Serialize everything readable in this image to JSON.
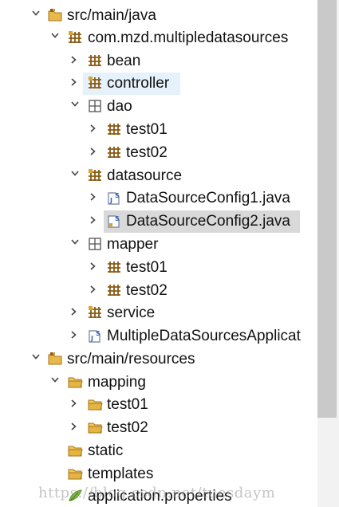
{
  "tree": {
    "items": [
      {
        "label": "src/main/java",
        "icon": "source-folder-icon",
        "expanded": true
      },
      {
        "label": "com.mzd.multipledatasources",
        "icon": "package-icon",
        "expanded": true
      },
      {
        "label": "bean",
        "icon": "package-icon",
        "expanded": false
      },
      {
        "label": "controller",
        "icon": "package-icon",
        "expanded": false,
        "highlighted": true
      },
      {
        "label": "dao",
        "icon": "empty-package-icon",
        "expanded": true
      },
      {
        "label": "test01",
        "icon": "package-icon",
        "expanded": false
      },
      {
        "label": "test02",
        "icon": "package-icon",
        "expanded": false
      },
      {
        "label": "datasource",
        "icon": "package-icon",
        "expanded": true
      },
      {
        "label": "DataSourceConfig1.java",
        "icon": "java-file-icon",
        "expanded": false
      },
      {
        "label": "DataSourceConfig2.java",
        "icon": "java-file-icon",
        "expanded": false,
        "selected": true
      },
      {
        "label": "mapper",
        "icon": "empty-package-icon",
        "expanded": true
      },
      {
        "label": "test01",
        "icon": "package-icon",
        "expanded": false
      },
      {
        "label": "test02",
        "icon": "package-icon",
        "expanded": false
      },
      {
        "label": "service",
        "icon": "package-icon",
        "expanded": false
      },
      {
        "label": "MultipleDataSourcesApplicat",
        "icon": "java-file-icon",
        "expanded": false
      },
      {
        "label": "src/main/resources",
        "icon": "source-folder-icon",
        "expanded": true
      },
      {
        "label": "mapping",
        "icon": "folder-icon",
        "expanded": true
      },
      {
        "label": "test01",
        "icon": "folder-icon",
        "expanded": false
      },
      {
        "label": "test02",
        "icon": "folder-icon",
        "expanded": false
      },
      {
        "label": "static",
        "icon": "folder-icon"
      },
      {
        "label": "templates",
        "icon": "folder-icon"
      },
      {
        "label": "application.properties",
        "icon": "properties-file-icon"
      }
    ]
  },
  "watermark": "https://blog.csdn.net/tuesdaym",
  "colors": {
    "highlight": "#e5f1fb",
    "selected": "#d9d9d9",
    "package": "#8a5a12",
    "folder": "#d9a634",
    "java_file": "#3b64b5"
  }
}
